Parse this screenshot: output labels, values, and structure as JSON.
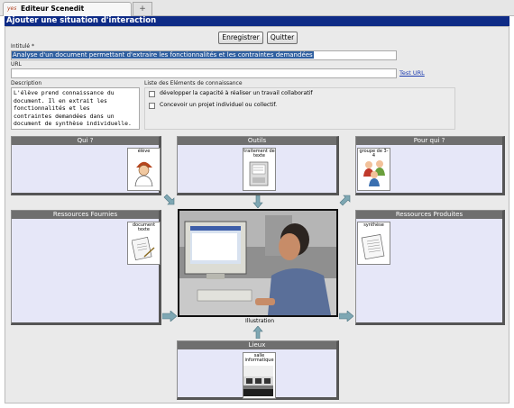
{
  "browser": {
    "tab_title": "Editeur Scenedit",
    "favicon": "yes",
    "new_tab": "+"
  },
  "page": {
    "title": "Ajouter une situation d'interaction"
  },
  "toolbar": {
    "save_label": "Enregistrer",
    "quit_label": "Quitter"
  },
  "form": {
    "title_label": "Intitulé *",
    "title_value": "Analyse d'un document permettant d'extraire les fonctionnalités et les contraintes demandées",
    "url_label": "URL",
    "url_value": "",
    "test_url": "Test URL",
    "description_label": "Description",
    "description_lines": [
      "L'élève prend connaissance du",
      "document. Il en extrait les",
      "fonctionnalités et les",
      "contraintes demandées dans un",
      "document de synthèse individuelle."
    ],
    "knowledge_label": "Liste des Eléments de connaissance",
    "knowledge_items": [
      "développer la capacité à réaliser un travail collaboratif",
      "Concevoir un projet individuel ou collectif."
    ]
  },
  "panels": {
    "qui": {
      "header": "Qui ?",
      "card": "élève",
      "icon": "student-icon"
    },
    "outils": {
      "header": "Outils",
      "card": "traitement de texte",
      "icon": "word-processor-icon"
    },
    "pour_qui": {
      "header": "Pour qui ?",
      "card": "groupe de 3-4",
      "icon": "group-icon"
    },
    "ressources_fournies": {
      "header": "Ressources Fournies",
      "card": "document texte",
      "icon": "document-icon"
    },
    "ressources_produites": {
      "header": "Ressources Produites",
      "card": "synthèse",
      "icon": "summary-icon"
    },
    "lieux": {
      "header": "Lieux",
      "card": "salle informatique",
      "icon": "computer-room-icon"
    }
  },
  "illustration": {
    "caption": "Illustration"
  },
  "colors": {
    "header_bg": "#0e2b86",
    "panel_bg": "#e6e7f8",
    "panel_header": "#6f6f6f",
    "arrow": "#7ea7b3"
  }
}
